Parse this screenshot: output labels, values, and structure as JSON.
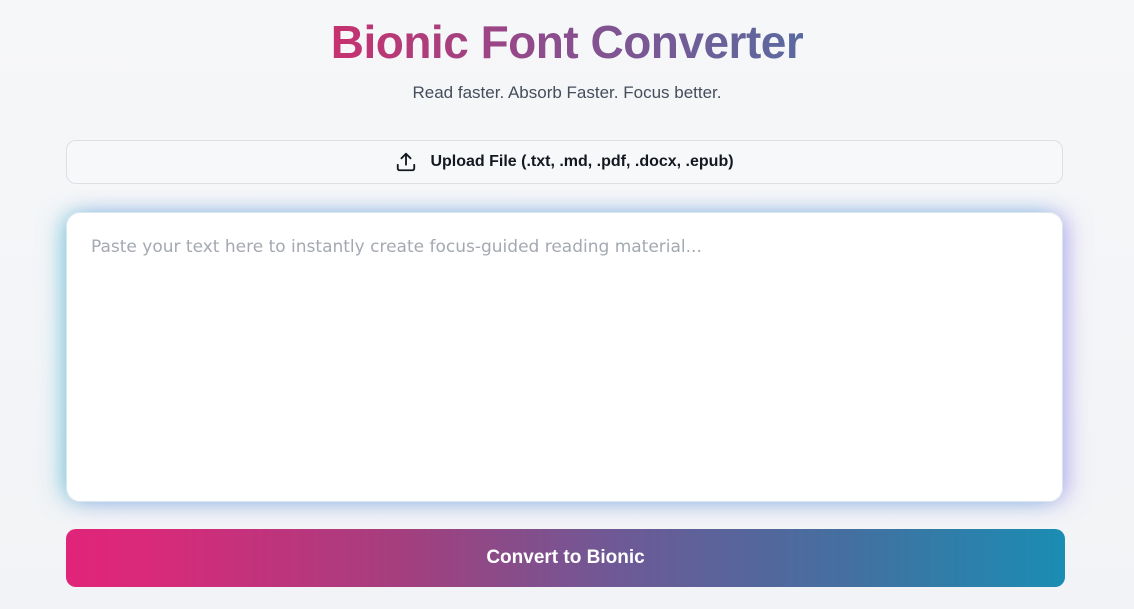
{
  "header": {
    "title": "Bionic Font Converter",
    "subtitle": "Read faster. Absorb Faster. Focus better."
  },
  "upload": {
    "icon": "upload-icon",
    "label": "Upload File (.txt, .md, .pdf, .docx, .epub)"
  },
  "editor": {
    "value": "",
    "placeholder": "Paste your text here to instantly create focus-guided reading material..."
  },
  "actions": {
    "convert_label": "Convert to Bionic"
  },
  "colors": {
    "title_gradient_start": "#c8316f",
    "title_gradient_end": "#5a6aa0",
    "button_gradient_start": "#e02479",
    "button_gradient_end": "#1a8db3"
  }
}
